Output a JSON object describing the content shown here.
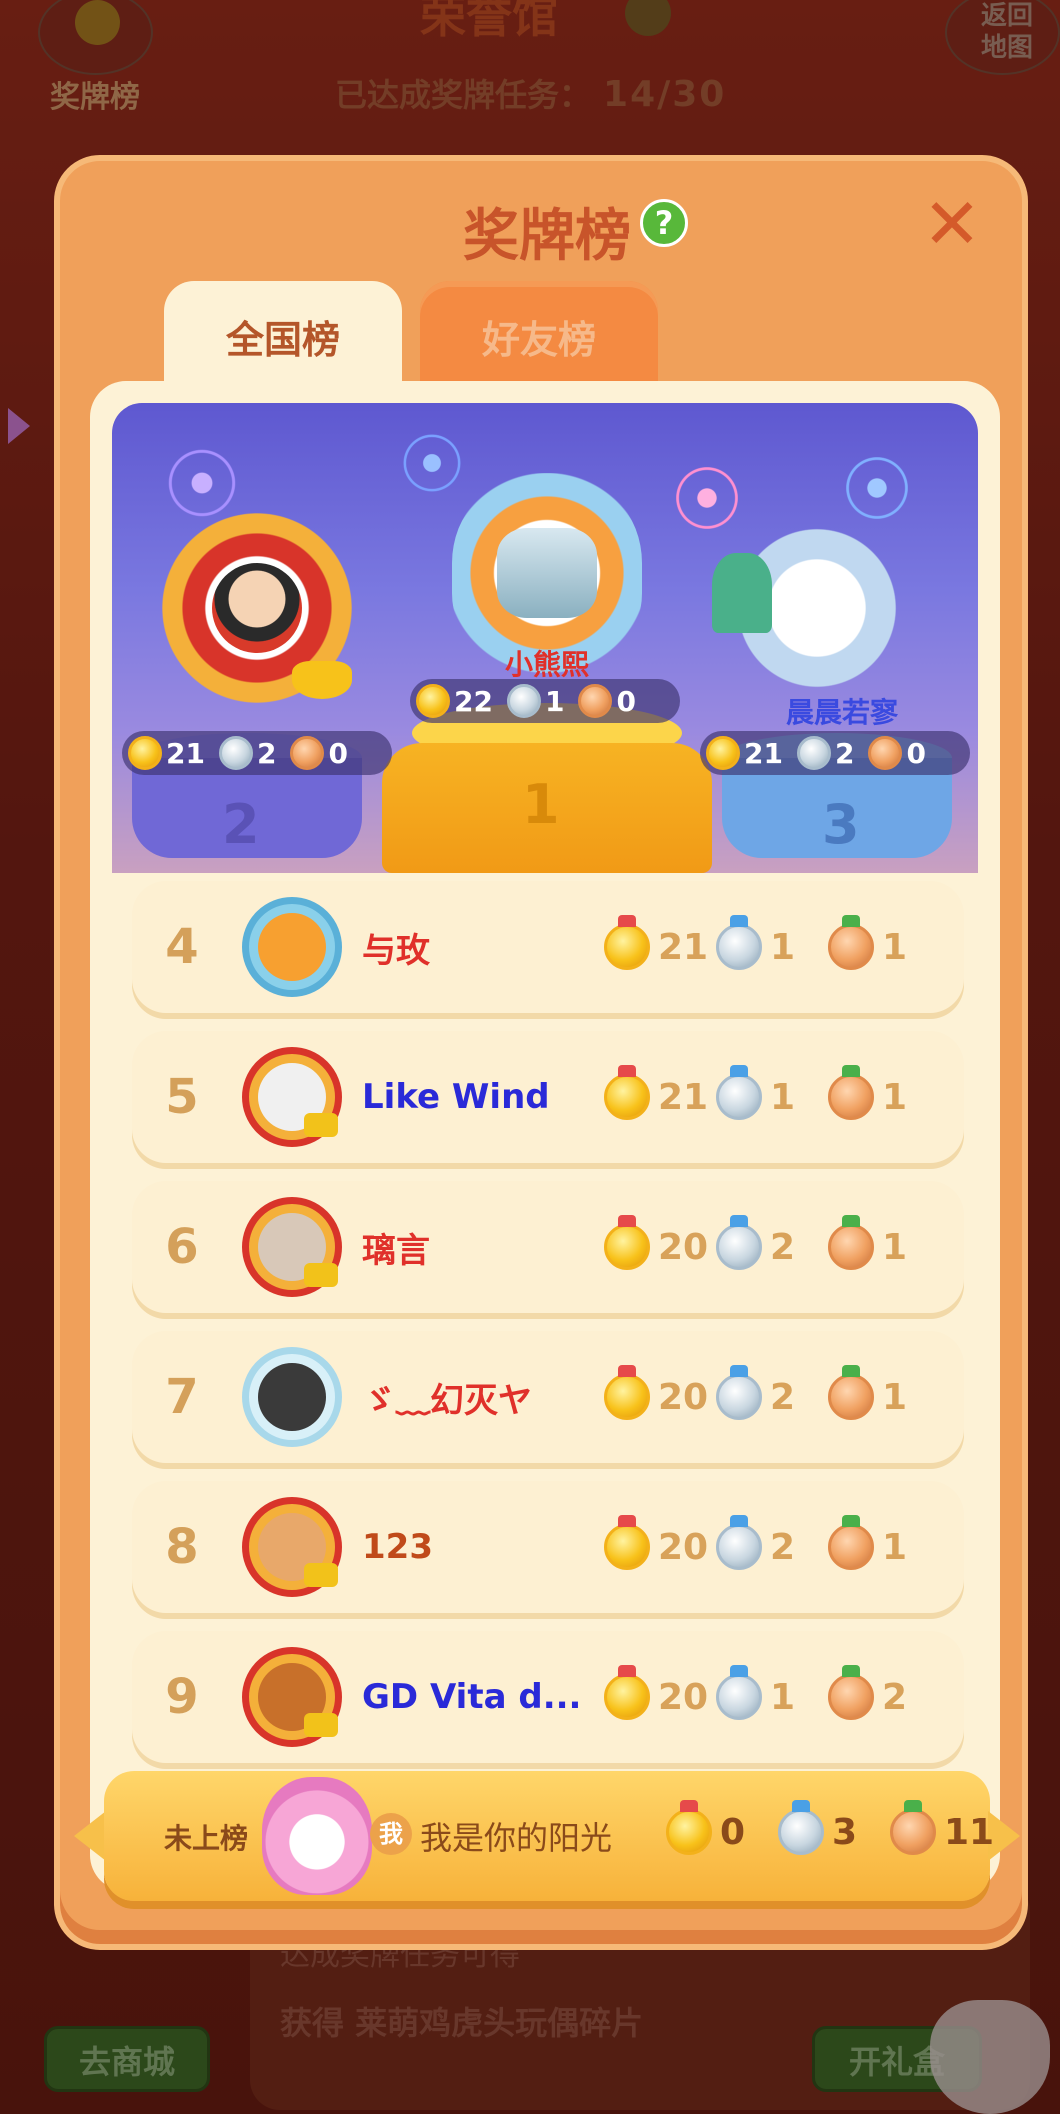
{
  "background": {
    "title": "荣誉馆",
    "medal_button_label": "奖牌榜",
    "back_button_label": "返回\n地图",
    "progress_label": "已达成奖牌任务：",
    "progress_value": "14/30",
    "bottom_text_1": "达成奖牌任务可得",
    "bottom_text_2": "获得 莱萌鸡虎头玩偶碎片",
    "shop_button_label": "去商城",
    "gift_button_label": "开礼盒"
  },
  "modal": {
    "title": "奖牌榜",
    "help_icon": "?",
    "close_icon": "✕",
    "tabs": [
      {
        "label": "全国榜",
        "active": true
      },
      {
        "label": "好友榜",
        "active": false
      }
    ]
  },
  "podium": [
    {
      "rank": "1",
      "name": "小熊熙",
      "name_color": "#e0302a",
      "gold": "22",
      "silver": "1",
      "bronze": "0"
    },
    {
      "rank": "2",
      "name": "",
      "name_color": "#333333",
      "gold": "21",
      "silver": "2",
      "bronze": "0"
    },
    {
      "rank": "3",
      "name": "晨晨若寥",
      "name_color": "#3a4ae0",
      "gold": "21",
      "silver": "2",
      "bronze": "0"
    }
  ],
  "rows": [
    {
      "rank": "4",
      "name": "与玫",
      "name_color": "#e0302a",
      "gold": "21",
      "silver": "1",
      "bronze": "1"
    },
    {
      "rank": "5",
      "name": "Like  Wind",
      "name_color": "#2a2ad8",
      "gold": "21",
      "silver": "1",
      "bronze": "1"
    },
    {
      "rank": "6",
      "name": "璃言",
      "name_color": "#e0302a",
      "gold": "20",
      "silver": "2",
      "bronze": "1"
    },
    {
      "rank": "7",
      "name": "ゞ﹏幻灭ヤ",
      "name_color": "#e0302a",
      "gold": "20",
      "silver": "2",
      "bronze": "1"
    },
    {
      "rank": "8",
      "name": "123",
      "name_color": "#c04a1a",
      "gold": "20",
      "silver": "2",
      "bronze": "1"
    },
    {
      "rank": "9",
      "name": "GD Vita d...",
      "name_color": "#2a2ad8",
      "gold": "20",
      "silver": "1",
      "bronze": "2"
    }
  ],
  "self": {
    "status": "未上榜",
    "me_badge": "我",
    "name": "我是你的阳光",
    "gold": "0",
    "silver": "3",
    "bronze": "11"
  },
  "colors": {
    "modal_bg": "#f0a05a",
    "title": "#c8542a",
    "rank_num": "#d4a05a",
    "medal_value": "#d8a25a"
  }
}
